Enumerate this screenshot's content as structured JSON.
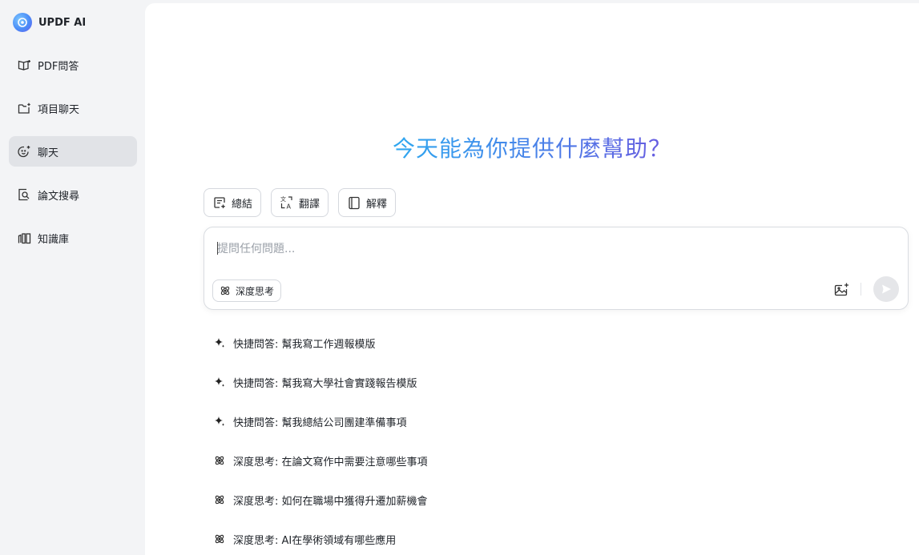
{
  "sidebar": {
    "brand": {
      "name": "UPDF AI"
    },
    "items": [
      {
        "label": "PDF問答",
        "icon": "book-open-icon",
        "active": false
      },
      {
        "label": "項目聊天",
        "icon": "folder-plus-icon",
        "active": false
      },
      {
        "label": "聊天",
        "icon": "chat-smile-icon",
        "active": true
      },
      {
        "label": "論文搜尋",
        "icon": "doc-search-icon",
        "active": false
      },
      {
        "label": "知識庫",
        "icon": "library-icon",
        "active": false
      }
    ]
  },
  "main": {
    "hero_title": "今天能為你提供什麼幫助？",
    "chips": [
      {
        "label": "總結",
        "icon": "summary-icon"
      },
      {
        "label": "翻譯",
        "icon": "translate-icon"
      },
      {
        "label": "解釋",
        "icon": "explain-book-icon"
      }
    ],
    "composer": {
      "placeholder": "提問任何問題...",
      "value": "",
      "deep_think_label": "深度思考"
    },
    "suggestions": [
      {
        "icon": "sparkle-icon",
        "text": "快捷問答: 幫我寫工作週報模版"
      },
      {
        "icon": "sparkle-icon",
        "text": "快捷問答: 幫我寫大學社會實踐報告模版"
      },
      {
        "icon": "sparkle-icon",
        "text": "快捷問答: 幫我總結公司團建準備事項"
      },
      {
        "icon": "atom-icon",
        "text": "深度思考: 在論文寫作中需要注意哪些事項"
      },
      {
        "icon": "atom-icon",
        "text": "深度思考: 如何在職場中獲得升遷加薪機會"
      },
      {
        "icon": "atom-icon",
        "text": "深度思考: AI在學術領域有哪些應用"
      }
    ]
  },
  "colors": {
    "sidebar_bg": "#f3f4f6",
    "active_item_bg": "#e1e3e7",
    "hero_gradient_start": "#2fa8f0",
    "hero_gradient_end": "#6a5ae0"
  }
}
